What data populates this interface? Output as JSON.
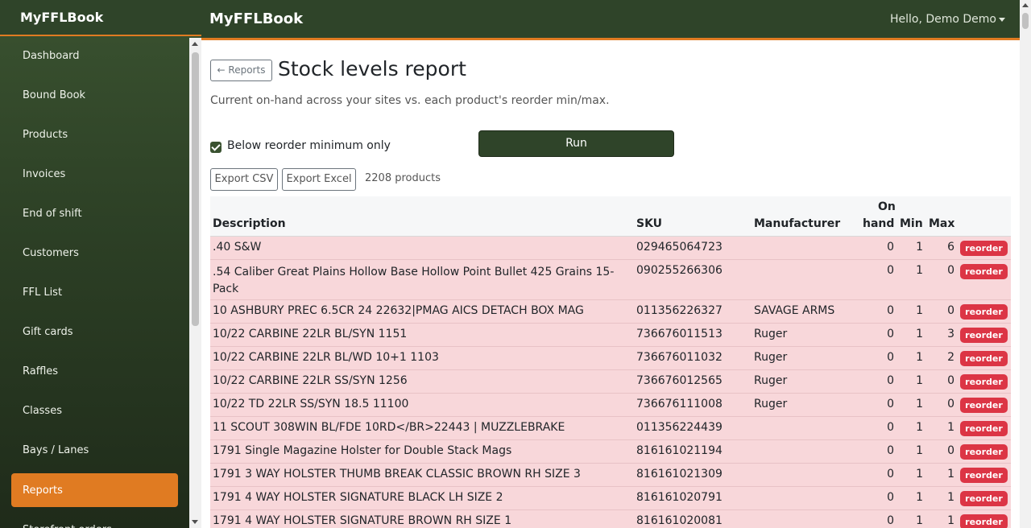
{
  "sidebar": {
    "brand": "MyFFLBook",
    "items": [
      {
        "label": "Dashboard"
      },
      {
        "label": "Bound Book"
      },
      {
        "label": "Products"
      },
      {
        "label": "Invoices"
      },
      {
        "label": "End of shift"
      },
      {
        "label": "Customers"
      },
      {
        "label": "FFL List"
      },
      {
        "label": "Gift cards"
      },
      {
        "label": "Raffles"
      },
      {
        "label": "Classes"
      },
      {
        "label": "Bays / Lanes"
      },
      {
        "label": "Reports"
      },
      {
        "label": "Storefront orders"
      }
    ],
    "active_item": "Reports"
  },
  "topbar": {
    "brand": "MyFFLBook",
    "user_menu": "Hello, Demo Demo"
  },
  "page": {
    "back_button": "← Reports",
    "title": "Stock levels report",
    "subtitle": "Current on-hand across your sites vs. each product's reorder min/max.",
    "filter_label": "Below reorder minimum only",
    "filter_checked": true,
    "run_button": "Run",
    "export_csv": "Export CSV",
    "export_excel": "Export Excel",
    "count": "2208 products"
  },
  "table": {
    "headers": {
      "description": "Description",
      "sku": "SKU",
      "manufacturer": "Manufacturer",
      "on_hand_1": "On",
      "on_hand_2": "hand",
      "min": "Min",
      "max": "Max"
    },
    "rows": [
      {
        "description": ".40 S&W",
        "sku": "029465064723",
        "manufacturer": "",
        "on_hand": "0",
        "min": "1",
        "max": "6",
        "badge": "reorder"
      },
      {
        "description": ".54 Caliber Great Plains Hollow Base Hollow Point Bullet 425 Grains 15-Pack",
        "sku": "090255266306",
        "manufacturer": "",
        "on_hand": "0",
        "min": "1",
        "max": "0",
        "badge": "reorder"
      },
      {
        "description": "10 ASHBURY PREC 6.5CR 24 22632|PMAG AICS DETACH BOX MAG",
        "sku": "011356226327",
        "manufacturer": "SAVAGE ARMS",
        "on_hand": "0",
        "min": "1",
        "max": "0",
        "badge": "reorder"
      },
      {
        "description": "10/22 CARBINE 22LR BL/SYN 1151",
        "sku": "736676011513",
        "manufacturer": "Ruger",
        "on_hand": "0",
        "min": "1",
        "max": "3",
        "badge": "reorder"
      },
      {
        "description": "10/22 CARBINE 22LR BL/WD 10+1 1103",
        "sku": "736676011032",
        "manufacturer": "Ruger",
        "on_hand": "0",
        "min": "1",
        "max": "2",
        "badge": "reorder"
      },
      {
        "description": "10/22 CARBINE 22LR SS/SYN 1256",
        "sku": "736676012565",
        "manufacturer": "Ruger",
        "on_hand": "0",
        "min": "1",
        "max": "0",
        "badge": "reorder"
      },
      {
        "description": "10/22 TD 22LR SS/SYN 18.5 11100",
        "sku": "736676111008",
        "manufacturer": "Ruger",
        "on_hand": "0",
        "min": "1",
        "max": "0",
        "badge": "reorder"
      },
      {
        "description": "11 SCOUT 308WIN BL/FDE 10RD</BR>22443 | MUZZLEBRAKE",
        "sku": "011356224439",
        "manufacturer": "",
        "on_hand": "0",
        "min": "1",
        "max": "1",
        "badge": "reorder"
      },
      {
        "description": "1791 Single Magazine Holster for Double Stack Mags",
        "sku": "816161021194",
        "manufacturer": "",
        "on_hand": "0",
        "min": "1",
        "max": "0",
        "badge": "reorder"
      },
      {
        "description": "1791 3 WAY HOLSTER THUMB BREAK CLASSIC BROWN RH SIZE 3",
        "sku": "816161021309",
        "manufacturer": "",
        "on_hand": "0",
        "min": "1",
        "max": "1",
        "badge": "reorder"
      },
      {
        "description": "1791 4 WAY HOLSTER SIGNATURE BLACK LH SIZE 2",
        "sku": "816161020791",
        "manufacturer": "",
        "on_hand": "0",
        "min": "1",
        "max": "1",
        "badge": "reorder"
      },
      {
        "description": "1791 4 WAY HOLSTER SIGNATURE BROWN RH SIZE 1",
        "sku": "816161020081",
        "manufacturer": "",
        "on_hand": "0",
        "min": "1",
        "max": "1",
        "badge": "reorder"
      }
    ]
  },
  "colors": {
    "brand_green": "#2f4429",
    "accent_orange": "#e07b22",
    "row_danger_bg": "#f8d7da",
    "badge_red": "#dc3545"
  }
}
